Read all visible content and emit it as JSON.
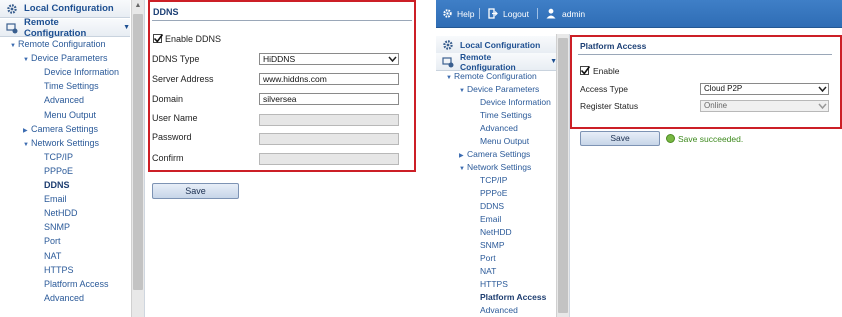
{
  "left": {
    "sidebar": {
      "local_config": "Local Configuration",
      "remote_config": "Remote Configuration",
      "tree": [
        {
          "label": "Remote Configuration",
          "indent": 1,
          "arrow": "down",
          "bold": false
        },
        {
          "label": "Device Parameters",
          "indent": 2,
          "arrow": "down",
          "bold": false
        },
        {
          "label": "Device Information",
          "indent": 3,
          "arrow": "",
          "bold": false
        },
        {
          "label": "Time Settings",
          "indent": 3,
          "arrow": "",
          "bold": false
        },
        {
          "label": "Advanced",
          "indent": 3,
          "arrow": "",
          "bold": false
        },
        {
          "label": "Menu Output",
          "indent": 3,
          "arrow": "",
          "bold": false
        },
        {
          "label": "Camera Settings",
          "indent": 2,
          "arrow": "right",
          "bold": false
        },
        {
          "label": "Network Settings",
          "indent": 2,
          "arrow": "down",
          "bold": false
        },
        {
          "label": "TCP/IP",
          "indent": 3,
          "arrow": "",
          "bold": false
        },
        {
          "label": "PPPoE",
          "indent": 3,
          "arrow": "",
          "bold": false
        },
        {
          "label": "DDNS",
          "indent": 3,
          "arrow": "",
          "bold": true
        },
        {
          "label": "Email",
          "indent": 3,
          "arrow": "",
          "bold": false
        },
        {
          "label": "NetHDD",
          "indent": 3,
          "arrow": "",
          "bold": false
        },
        {
          "label": "SNMP",
          "indent": 3,
          "arrow": "",
          "bold": false
        },
        {
          "label": "Port",
          "indent": 3,
          "arrow": "",
          "bold": false
        },
        {
          "label": "NAT",
          "indent": 3,
          "arrow": "",
          "bold": false
        },
        {
          "label": "HTTPS",
          "indent": 3,
          "arrow": "",
          "bold": false
        },
        {
          "label": "Platform Access",
          "indent": 3,
          "arrow": "",
          "bold": false
        },
        {
          "label": "Advanced",
          "indent": 3,
          "arrow": "",
          "bold": false
        }
      ]
    },
    "form": {
      "title": "DDNS",
      "enable_label": "Enable DDNS",
      "enable_checked": true,
      "ddns_type_label": "DDNS Type",
      "ddns_type_value": "HiDDNS",
      "server_label": "Server Address",
      "server_value": "www.hiddns.com",
      "domain_label": "Domain",
      "domain_value": "silversea",
      "user_label": "User Name",
      "user_value": "",
      "password_label": "Password",
      "password_value": "",
      "confirm_label": "Confirm",
      "confirm_value": "",
      "save_label": "Save"
    }
  },
  "right": {
    "topbar": {
      "help": "Help",
      "logout": "Logout",
      "user": "admin"
    },
    "sidebar": {
      "local_config": "Local Configuration",
      "remote_config": "Remote Configuration",
      "tree": [
        {
          "label": "Remote Configuration",
          "indent": 1,
          "arrow": "down",
          "bold": false
        },
        {
          "label": "Device Parameters",
          "indent": 2,
          "arrow": "down",
          "bold": false
        },
        {
          "label": "Device Information",
          "indent": 3,
          "arrow": "",
          "bold": false
        },
        {
          "label": "Time Settings",
          "indent": 3,
          "arrow": "",
          "bold": false
        },
        {
          "label": "Advanced",
          "indent": 3,
          "arrow": "",
          "bold": false
        },
        {
          "label": "Menu Output",
          "indent": 3,
          "arrow": "",
          "bold": false
        },
        {
          "label": "Camera Settings",
          "indent": 2,
          "arrow": "right",
          "bold": false
        },
        {
          "label": "Network Settings",
          "indent": 2,
          "arrow": "down",
          "bold": false
        },
        {
          "label": "TCP/IP",
          "indent": 3,
          "arrow": "",
          "bold": false
        },
        {
          "label": "PPPoE",
          "indent": 3,
          "arrow": "",
          "bold": false
        },
        {
          "label": "DDNS",
          "indent": 3,
          "arrow": "",
          "bold": false
        },
        {
          "label": "Email",
          "indent": 3,
          "arrow": "",
          "bold": false
        },
        {
          "label": "NetHDD",
          "indent": 3,
          "arrow": "",
          "bold": false
        },
        {
          "label": "SNMP",
          "indent": 3,
          "arrow": "",
          "bold": false
        },
        {
          "label": "Port",
          "indent": 3,
          "arrow": "",
          "bold": false
        },
        {
          "label": "NAT",
          "indent": 3,
          "arrow": "",
          "bold": false
        },
        {
          "label": "HTTPS",
          "indent": 3,
          "arrow": "",
          "bold": false
        },
        {
          "label": "Platform Access",
          "indent": 3,
          "arrow": "",
          "bold": true
        },
        {
          "label": "Advanced",
          "indent": 3,
          "arrow": "",
          "bold": false
        }
      ]
    },
    "form": {
      "title": "Platform Access",
      "enable_label": "Enable",
      "enable_checked": true,
      "access_type_label": "Access Type",
      "access_type_value": "Cloud P2P",
      "register_label": "Register Status",
      "register_value": "Online",
      "save_label": "Save",
      "status_message": "Save succeeded."
    }
  },
  "colors": {
    "highlight_border": "#cc1f26",
    "link_blue": "#2b5a99",
    "topbar_blue": "#3574bd",
    "success_green": "#3e8a1e"
  }
}
